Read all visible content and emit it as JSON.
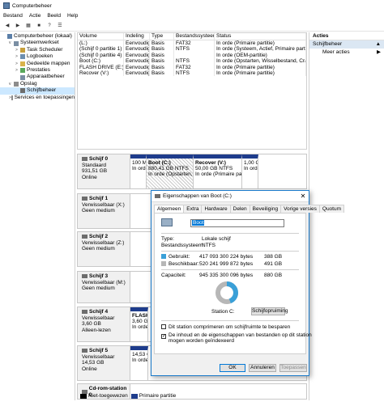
{
  "window": {
    "title": "Computerbeheer"
  },
  "menu": [
    "Bestand",
    "Actie",
    "Beeld",
    "Help"
  ],
  "tree": [
    {
      "label": "Computerbeheer (lokaal)",
      "indent": 0,
      "exp": ""
    },
    {
      "label": "Systeemwerkset",
      "indent": 1,
      "exp": "v"
    },
    {
      "label": "Task Scheduler",
      "indent": 2,
      "exp": ">"
    },
    {
      "label": "Logboeken",
      "indent": 2,
      "exp": ">"
    },
    {
      "label": "Gedeelde mappen",
      "indent": 2,
      "exp": ">"
    },
    {
      "label": "Prestaties",
      "indent": 2,
      "exp": ">"
    },
    {
      "label": "Apparaatbeheer",
      "indent": 2,
      "exp": ""
    },
    {
      "label": "Opslag",
      "indent": 1,
      "exp": "v"
    },
    {
      "label": "Schijfbeheer",
      "indent": 2,
      "exp": ""
    },
    {
      "label": "Services en toepassingen",
      "indent": 1,
      "exp": ">"
    }
  ],
  "volume_list": {
    "headers": [
      "Volume",
      "Indeling",
      "Type",
      "Bestandssysteem",
      "Status"
    ],
    "rows": [
      [
        "(L:)",
        "Eenvoudig",
        "Basis",
        "FAT32",
        "In orde (Primaire partitie)"
      ],
      [
        "(Schijf 0 partitie 1)",
        "Eenvoudig",
        "Basis",
        "NTFS",
        "In orde (Systeem, Actief, Primaire partitie)"
      ],
      [
        "(Schijf 0 partitie 4)",
        "Eenvoudig",
        "Basis",
        "",
        "In orde (OEM-partitie)"
      ],
      [
        "Boot (C:)",
        "Eenvoudig",
        "Basis",
        "NTFS",
        "In orde (Opstarten, Wisselbestand, Crashdum"
      ],
      [
        "FLASH DRIVE (E:)",
        "Eenvoudig",
        "Basis",
        "FAT32",
        "In orde (Primaire partitie)"
      ],
      [
        "Recover (V:)",
        "Eenvoudig",
        "Basis",
        "NTFS",
        "In orde (Primaire partitie)"
      ]
    ]
  },
  "disks": [
    {
      "name": "Schijf 0",
      "l1": "Standaard",
      "l2": "931,51 GB",
      "l3": "Online",
      "parts": [
        {
          "t1": "",
          "t2": "100 MB",
          "t3": "In orde (",
          "hatch": false
        },
        {
          "t1": "Boot (C:)",
          "t2": "880,41 GB NTFS",
          "t3": "In orde (Opstarten, Wisselbe",
          "hatch": true
        },
        {
          "t1": "Recover (V:)",
          "t2": "50,00 GB NTFS",
          "t3": "In orde (Primaire partitie",
          "hatch": false
        },
        {
          "t1": "",
          "t2": "1,00 GB",
          "t3": "In orde (",
          "hatch": false
        }
      ]
    },
    {
      "name": "Schijf 1",
      "l1": "Verwisselbaar (X:)",
      "l2": "",
      "l3": "Geen medium",
      "parts": []
    },
    {
      "name": "Schijf 2",
      "l1": "Verwisselbaar (Z:)",
      "l2": "",
      "l3": "Geen medium",
      "parts": []
    },
    {
      "name": "Schijf 3",
      "l1": "Verwisselbaar (M:)",
      "l2": "",
      "l3": "Geen medium",
      "parts": []
    },
    {
      "name": "Schijf 4",
      "l1": "Verwisselbaar",
      "l2": "3,60 GB",
      "l3": "Alleen-lezen",
      "parts": [
        {
          "t1": "FLASH",
          "t2": "3,60 G",
          "t3": "In orde",
          "hatch": false
        }
      ]
    },
    {
      "name": "Schijf 5",
      "l1": "Verwisselbaar",
      "l2": "14,53 GB",
      "l3": "Online",
      "parts": [
        {
          "t1": "",
          "t2": "14,53 G",
          "t3": "In orde",
          "hatch": false
        }
      ]
    },
    {
      "name": "Cd-rom-station 0",
      "l1": "",
      "l2": "",
      "l3": "",
      "parts": []
    }
  ],
  "legend": [
    {
      "label": "Niet-toegewezen",
      "color": "#000000"
    },
    {
      "label": "Primaire partitie",
      "color": "#1e3c8c"
    }
  ],
  "actions": {
    "header": "Acties",
    "section": "Schijfbeheer",
    "more": "Meer acties"
  },
  "dialog": {
    "title": "Eigenschappen van Boot (C:)",
    "tabs": [
      "Algemeen",
      "Extra",
      "Hardware",
      "Delen",
      "Beveiliging",
      "Vorige versies",
      "Quotum"
    ],
    "name_value": "Boot",
    "type_label": "Type:",
    "type_value": "Lokale schijf",
    "fs_label": "Bestandssysteem:",
    "fs_value": "NTFS",
    "used_label": "Gebruikt:",
    "used_bytes": "417 093 300 224 bytes",
    "used_gb": "388 GB",
    "used_color": "#3aa0d8",
    "free_label": "Beschikbaar:",
    "free_bytes": "520 241 999 872 bytes",
    "free_gb": "491 GB",
    "free_color": "#b7b7b7",
    "cap_label": "Capaciteit:",
    "cap_bytes": "945 335 300 096 bytes",
    "cap_gb": "880 GB",
    "used_fraction": 0.44,
    "station_label": "Station C:",
    "cleanup_button": "Schijfopruiming",
    "check1": "Dit station comprimeren om schijfruimte te besparen",
    "check2a": "De inhoud en de eigenschappen van bestanden op dit station",
    "check2b": "mogen worden geïndexeerd",
    "ok": "OK",
    "cancel": "Annuleren",
    "apply": "Toepassen"
  }
}
